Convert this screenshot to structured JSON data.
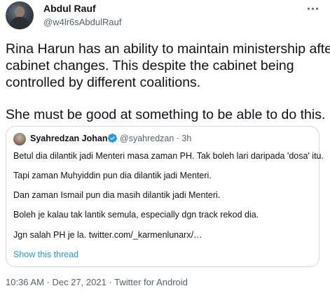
{
  "author": {
    "name": "Abdul Rauf",
    "handle": "@w4lr6sAbdulRauf"
  },
  "tweet": {
    "lines": [
      "Rina Harun has an ability to maintain ministership after",
      "cabinet changes. This despite the cabinet being",
      "controlled by different coalitions.",
      "She must be good at something to be able to do this."
    ]
  },
  "quote": {
    "name": "Syahredzan Johan",
    "meta": "@syahredzan · 3h",
    "lines": [
      "Betul dia dilantik jadi Menteri masa zaman PH. Tak boleh lari daripada 'dosa' itu.",
      "Tapi zaman Muhyiddin pun dia dilantik jadi Menteri.",
      "Dan zaman Ismail pun dia masih dilantik jadi Menteri.",
      "Boleh je kalau tak lantik semula, especially dgn track rekod dia.",
      "Jgn salah PH je la. twitter.com/_karmenlunarx/…"
    ],
    "show_thread": "Show this thread"
  },
  "footer": {
    "meta": "10:36 AM · Dec 27, 2021 · Twitter for Android"
  },
  "colors": {
    "text": "#0f1419",
    "secondary": "#536471",
    "link": "#1d9bf0",
    "border": "#cfd9de"
  }
}
